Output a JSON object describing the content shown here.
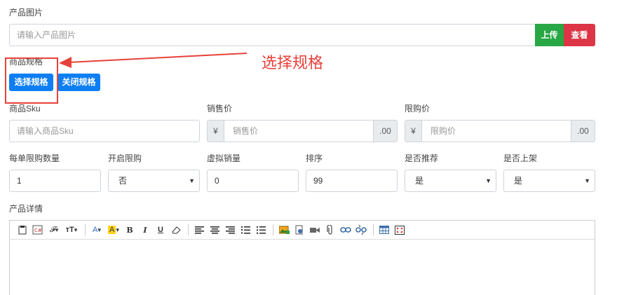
{
  "product_image": {
    "label": "产品图片",
    "placeholder": "请输入产品图片",
    "upload_label": "上传",
    "view_label": "查看"
  },
  "spec": {
    "label": "商品规格",
    "select_label": "选择规格",
    "close_label": "关闭规格",
    "annotation": "选择规格"
  },
  "sku": {
    "label": "商品Sku",
    "placeholder": "请输入商品Sku"
  },
  "sale_price": {
    "label": "销售价",
    "prefix": "¥",
    "placeholder": "销售价",
    "suffix": ".00"
  },
  "limit_price": {
    "label": "限购价",
    "prefix": "¥",
    "placeholder": "限购价",
    "suffix": ".00"
  },
  "limit_qty": {
    "label": "每单限购数量",
    "value": "1"
  },
  "enable_limit": {
    "label": "开启限购",
    "value": "否"
  },
  "virtual_sales": {
    "label": "虚拟销量",
    "value": "0"
  },
  "sort": {
    "label": "排序",
    "value": "99"
  },
  "recommend": {
    "label": "是否推荐",
    "value": "是"
  },
  "on_shelf": {
    "label": "是否上架",
    "value": "是"
  },
  "details": {
    "label": "产品详情"
  },
  "colors": {
    "success": "#28a745",
    "danger": "#dc3545",
    "primary": "#0d7ef3",
    "annotation": "#e8413a"
  },
  "toolbar_icons": [
    "paste-icon",
    "code-icon",
    "font-family-icon",
    "font-size-icon",
    "font-color-icon",
    "highlight-icon",
    "bold-icon",
    "italic-icon",
    "underline-icon",
    "eraser-icon",
    "align-left-icon",
    "align-center-icon",
    "align-right-icon",
    "ordered-list-icon",
    "unordered-list-icon",
    "image-icon",
    "media-icon",
    "video-icon",
    "attachment-icon",
    "link-icon",
    "unlink-icon",
    "table-icon",
    "fullscreen-icon"
  ]
}
